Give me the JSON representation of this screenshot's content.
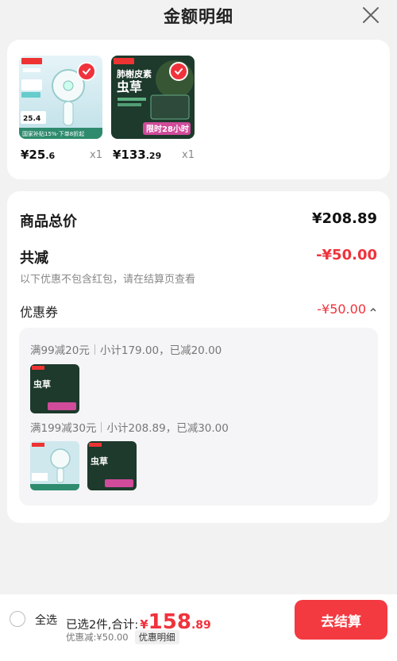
{
  "header": {
    "title": "金额明细"
  },
  "products": [
    {
      "name": "fan",
      "price_int": "¥25",
      "price_dec": ".6",
      "qty": "x1",
      "img": {
        "badge": "京东京造",
        "lines": [
          "国家补贴15%",
          "25.4"
        ],
        "bottom": "国家补贴15%·下单8折起"
      }
    },
    {
      "name": "cordyceps",
      "price_int": "¥133",
      "price_dec": ".29",
      "qty": "x1",
      "img": {
        "badge": "京东京造",
        "title1": "肺榭皮素",
        "title2": "虫草",
        "promo": "限时28小时"
      }
    }
  ],
  "summary": {
    "total_label": "商品总价",
    "total_value": "¥208.89",
    "reduce_label": "共减",
    "reduce_value": "-¥50.00",
    "note": "以下优惠不包含红包，请在结算页查看",
    "coupon_label": "优惠券",
    "coupon_value": "-¥50.00"
  },
  "coupons": [
    {
      "rule": "满99减20元",
      "detail": "小计179.00，已减20.00"
    },
    {
      "rule": "满199减30元",
      "detail": "小计208.89，已减30.00"
    }
  ],
  "footer": {
    "select_all": "全选",
    "selected_text": "已选2件,合计:",
    "currency": "¥",
    "total_int": "158",
    "total_dec": ".89",
    "discount": "优惠减:¥50.00",
    "detail_chip": "优惠明细",
    "checkout": "去结算"
  },
  "colors": {
    "accent": "#f0323c",
    "button": "#f33a41"
  }
}
